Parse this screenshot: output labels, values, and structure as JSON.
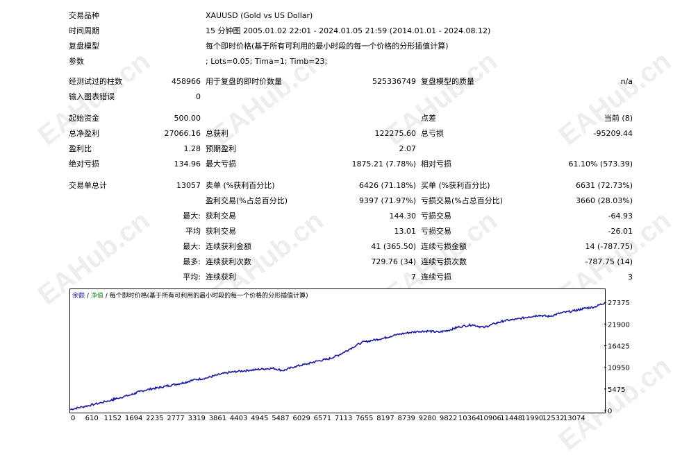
{
  "watermark": "EAHub.cn",
  "info": {
    "symbol_label": "交易品种",
    "symbol_value": "XAUUSD (Gold vs US Dollar)",
    "period_label": "时间周期",
    "period_value": "15 分钟图 2005.01.02 22:01 - 2024.01.05 21:59 (2014.01.01 - 2024.08.12)",
    "model_label": "复盘模型",
    "model_value": "每个即时价格(基于所有可利用的最小时段的每一个价格的分形插值计算)",
    "params_label": "参数",
    "params_value": "; Lots=0.05; Tima=1; Timb=23;"
  },
  "stats": {
    "bars_label": "经测试过的柱数",
    "bars_value": "458966",
    "ticks_label": "用于复盘的即时价数量",
    "ticks_value": "525336749",
    "quality_label": "复盘模型的质量",
    "quality_value": "n/a",
    "errors_label": "输入图表错误",
    "errors_value": "0",
    "deposit_label": "起始资金",
    "deposit_value": "500.00",
    "spread_label": "点差",
    "spread_value": "当前 (8)",
    "net_label": "总净盈利",
    "net_value": "27066.16",
    "gross_profit_label": "总获利",
    "gross_profit_value": "122275.60",
    "gross_loss_label": "总亏损",
    "gross_loss_value": "-95209.44",
    "pf_label": "盈利比",
    "pf_value": "1.28",
    "exp_label": "预期盈利",
    "exp_value": "2.07",
    "abs_dd_label": "绝对亏损",
    "abs_dd_value": "134.96",
    "max_dd_label": "最大亏损",
    "max_dd_value": "1875.21 (7.78%)",
    "rel_dd_label": "相对亏损",
    "rel_dd_value": "61.10% (573.39)",
    "total_trades_label": "交易单总计",
    "total_trades_value": "13057",
    "short_label": "卖单 (%获利百分比)",
    "short_value": "6426 (71.18%)",
    "long_label": "买单 (%获利百分比)",
    "long_value": "6631 (72.73%)",
    "profit_trades_label": "盈利交易(%占总百分比)",
    "profit_trades_value": "9397 (71.97%)",
    "loss_trades_label": "亏损交易(%占总百分比)",
    "loss_trades_value": "3660 (28.03%)",
    "max_label": "最大:",
    "largest_profit_label": "获利交易",
    "largest_profit_value": "144.30",
    "largest_loss_label": "亏损交易",
    "largest_loss_value": "-64.93",
    "avg_label": "平均",
    "avg_profit_label": "获利交易",
    "avg_profit_value": "13.01",
    "avg_loss_label": "亏损交易",
    "avg_loss_value": "-26.01",
    "max2_label": "最大:",
    "cons_wins_amt_label": "连续获利金额",
    "cons_wins_amt_value": "41 (365.50)",
    "cons_loss_amt_label": "连续亏损金额",
    "cons_loss_amt_value": "14 (-787.75)",
    "most_label": "最多:",
    "cons_profit_label": "连续获利次数",
    "cons_profit_value": "729.76 (34)",
    "cons_loss_label": "连续亏损次数",
    "cons_loss_value": "-787.75 (14)",
    "avg2_label": "平均:",
    "avg_cons_win_label": "连续获利",
    "avg_cons_win_value": "7",
    "avg_cons_loss_label": "连续亏损",
    "avg_cons_loss_value": "3"
  },
  "legend": {
    "balance": "余额",
    "sep1": "/",
    "equity": "净值",
    "sep2": "/",
    "model": "每个即时价格(基于所有可利用的最小时段的每一个价格的分形插值计算)"
  },
  "chart_data": {
    "type": "line",
    "x_ticks": [
      "0",
      "610",
      "1152",
      "1694",
      "2235",
      "2777",
      "3319",
      "3861",
      "4403",
      "4945",
      "5487",
      "6029",
      "6571",
      "7113",
      "7655",
      "8197",
      "8739",
      "9280",
      "9822",
      "10364",
      "10906",
      "11448",
      "11990",
      "12532",
      "13074"
    ],
    "y_ticks": [
      "0",
      "5475",
      "10950",
      "16425",
      "21900",
      "27375"
    ],
    "ylim": [
      0,
      29500
    ],
    "xlim": [
      0,
      13057
    ],
    "colors": {
      "balance": "#1a1aa0"
    },
    "series": [
      {
        "name": "余额",
        "points": [
          [
            0,
            450
          ],
          [
            300,
            1100
          ],
          [
            610,
            1800
          ],
          [
            1000,
            2800
          ],
          [
            1152,
            3300
          ],
          [
            1500,
            4200
          ],
          [
            1694,
            5000
          ],
          [
            2000,
            5700
          ],
          [
            2235,
            6100
          ],
          [
            2500,
            6700
          ],
          [
            2777,
            7200
          ],
          [
            3000,
            7900
          ],
          [
            3319,
            8400
          ],
          [
            3600,
            9200
          ],
          [
            3861,
            9800
          ],
          [
            4100,
            10100
          ],
          [
            4403,
            10400
          ],
          [
            4700,
            10700
          ],
          [
            4945,
            10900
          ],
          [
            5200,
            10300
          ],
          [
            5487,
            11300
          ],
          [
            5800,
            12000
          ],
          [
            6029,
            12700
          ],
          [
            6300,
            13200
          ],
          [
            6571,
            14300
          ],
          [
            6800,
            15600
          ],
          [
            7113,
            17400
          ],
          [
            7400,
            18000
          ],
          [
            7655,
            18500
          ],
          [
            7900,
            19200
          ],
          [
            8197,
            19800
          ],
          [
            8500,
            20200
          ],
          [
            8739,
            20300
          ],
          [
            9000,
            20000
          ],
          [
            9280,
            20600
          ],
          [
            9500,
            21400
          ],
          [
            9822,
            21900
          ],
          [
            10100,
            21200
          ],
          [
            10364,
            22200
          ],
          [
            10600,
            22900
          ],
          [
            10906,
            23300
          ],
          [
            11200,
            23900
          ],
          [
            11448,
            24300
          ],
          [
            11700,
            24000
          ],
          [
            11990,
            24900
          ],
          [
            12300,
            25400
          ],
          [
            12532,
            26000
          ],
          [
            12800,
            26400
          ],
          [
            13057,
            27500
          ]
        ]
      }
    ]
  }
}
